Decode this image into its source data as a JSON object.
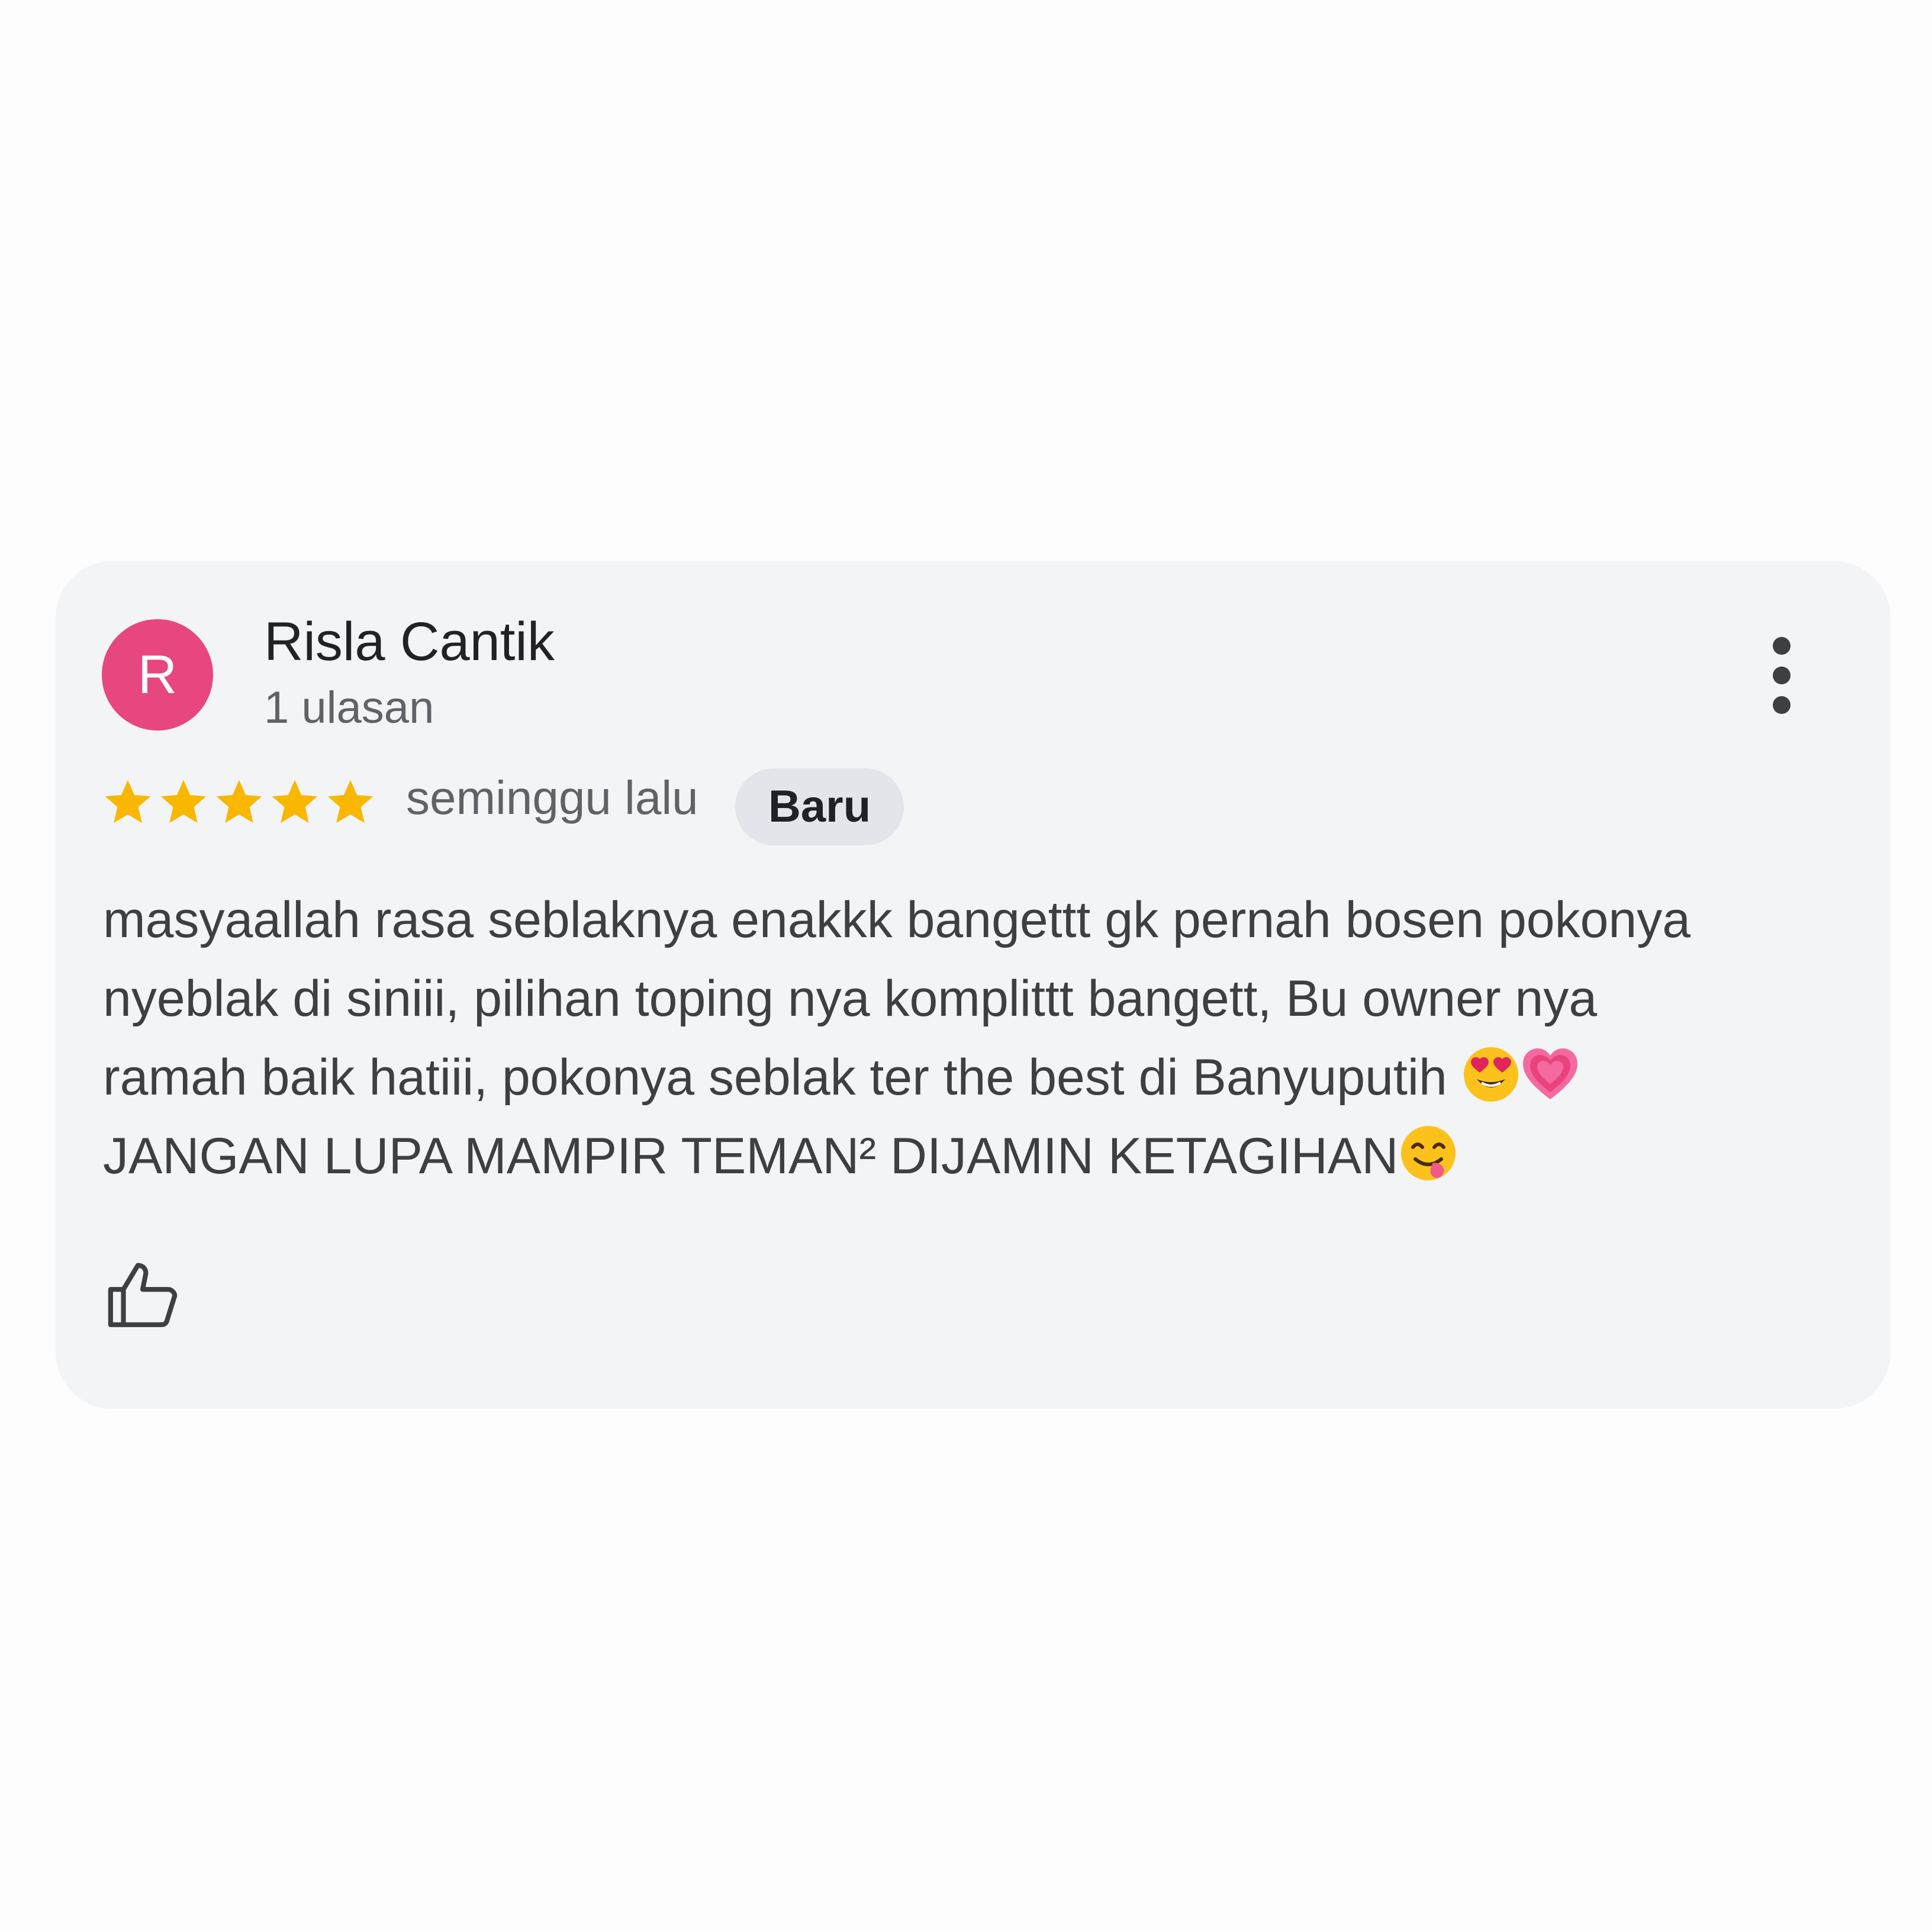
{
  "review": {
    "avatar_letter": "R",
    "avatar_color": "#e8467f",
    "reviewer_name": "Risla Cantik",
    "reviewer_meta": "1 ulasan",
    "rating": 5,
    "rating_max": 5,
    "star_color": "#f9b700",
    "time_ago": "seminggu lalu",
    "badge": "Baru",
    "text_lines": [
      "masyaallah rasa seblaknya enakkk bangettt gk pernah bosen pokonya",
      "nyeblak di siniii, pilihan toping nya komplittt bangett, Bu owner nya",
      "ramah baik hatiii, pokonya seblak ter the best di Banyuputih ",
      "JANGAN LUPA MAMPIR TEMAN² DIJAMIN KETAGIHAN"
    ],
    "emojis": {
      "line3": [
        "heart-eyes-emoji",
        "growing-heart-emoji"
      ],
      "line4": [
        "yum-emoji"
      ]
    }
  },
  "icons": {
    "more": "more-vertical-icon",
    "like": "thumbs-up-icon",
    "star": "star-icon"
  }
}
